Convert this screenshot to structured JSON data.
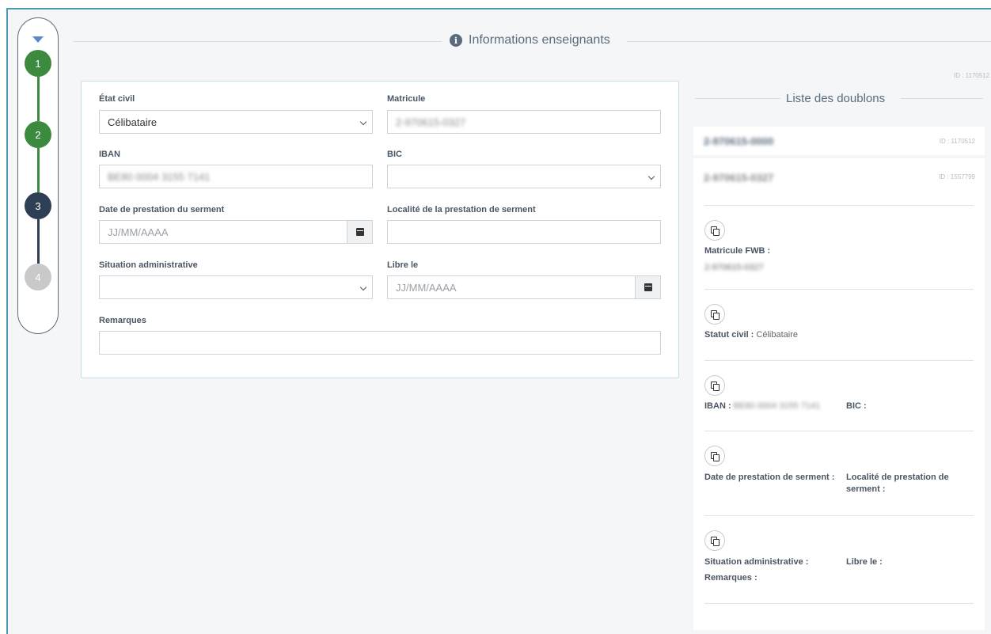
{
  "stepper": {
    "steps": [
      "1",
      "2",
      "3",
      "4"
    ]
  },
  "header": {
    "title": "Informations enseignants"
  },
  "form": {
    "etat_civil": {
      "label": "État civil",
      "value": "Célibataire"
    },
    "matricule": {
      "label": "Matricule",
      "value": "2-970615-0327"
    },
    "iban": {
      "label": "IBAN",
      "value": "BE80 0004 3155 7141"
    },
    "bic": {
      "label": "BIC",
      "value": ""
    },
    "date_serment": {
      "label": "Date de prestation du serment",
      "placeholder": "JJ/MM/AAAA"
    },
    "localite_serment": {
      "label": "Localité de la prestation de serment",
      "value": ""
    },
    "situation_admin": {
      "label": "Situation administrative",
      "value": ""
    },
    "libre_le": {
      "label": "Libre le",
      "placeholder": "JJ/MM/AAAA"
    },
    "remarques": {
      "label": "Remarques",
      "value": ""
    }
  },
  "duplicates": {
    "top_id": "ID : 1170512",
    "title": "Liste des doublons",
    "rows": [
      {
        "matricule": "2-970615-0000",
        "id": "ID : 1170512"
      },
      {
        "matricule": "2-970615-0327",
        "id": "ID : 1557799"
      }
    ],
    "detail": {
      "matricule_fwb_label": "Matricule FWB :",
      "matricule_fwb_value": "2-970615-0327",
      "statut_civil_label": "Statut civil :",
      "statut_civil_value": "Célibataire",
      "iban_label": "IBAN :",
      "iban_value": "BE80 0004 3155 7141",
      "bic_label": "BIC :",
      "date_serment_label": "Date de prestation de serment :",
      "localite_serment_label": "Localité de prestation de serment :",
      "situation_admin_label": "Situation administrative :",
      "libre_le_label": "Libre le :",
      "remarques_label": "Remarques :"
    }
  }
}
